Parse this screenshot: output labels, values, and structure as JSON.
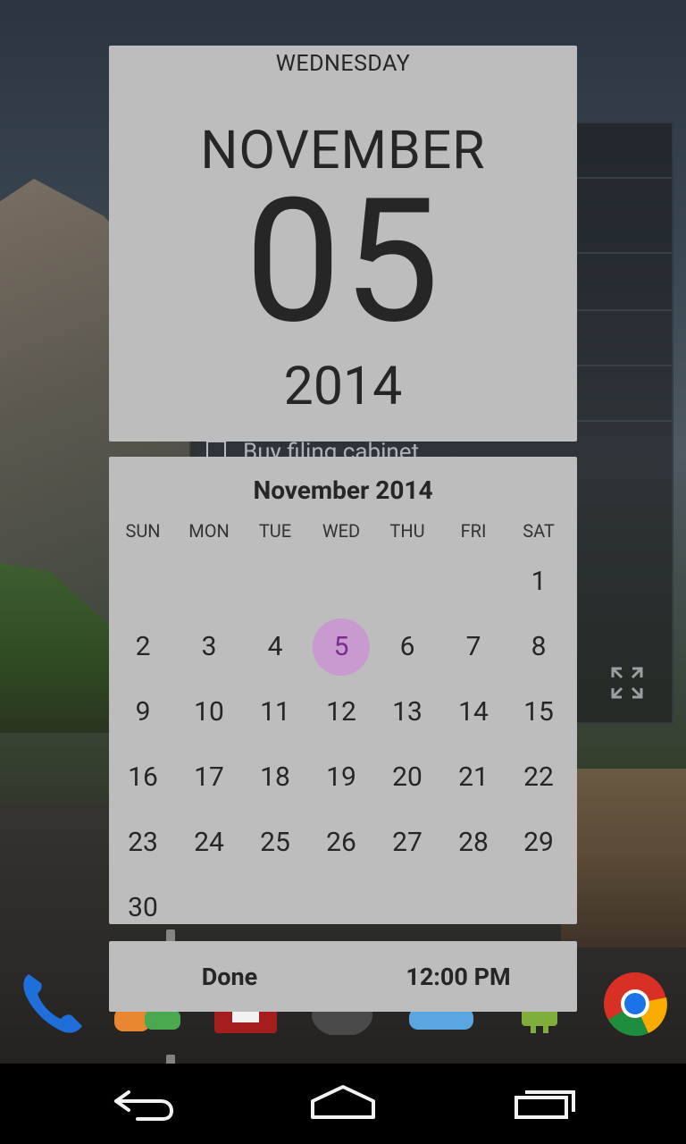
{
  "background_widget": {
    "task_text": "Buy filing cabinet"
  },
  "date_header": {
    "weekday": "WEDNESDAY",
    "month": "NOVEMBER",
    "day": "05",
    "year": "2014"
  },
  "calendar": {
    "title": "November 2014",
    "weekdays": [
      "SUN",
      "MON",
      "TUE",
      "WED",
      "THU",
      "FRI",
      "SAT"
    ],
    "days": [
      "1",
      "2",
      "3",
      "4",
      "5",
      "6",
      "7",
      "8",
      "9",
      "10",
      "11",
      "12",
      "13",
      "14",
      "15",
      "16",
      "17",
      "18",
      "19",
      "20",
      "21",
      "22",
      "23",
      "24",
      "25",
      "26",
      "27",
      "28",
      "29",
      "30"
    ],
    "selected_day": "5",
    "selected_color": "#c99ad0",
    "selected_text_color": "#7b2d8e"
  },
  "actions": {
    "done_label": "Done",
    "time_label": "12:00 PM"
  },
  "dock": {
    "icons": [
      "phone-icon",
      "hangouts-icon",
      "store-icon",
      "camera-icon",
      "weather-icon",
      "android-icon",
      "chrome-icon"
    ]
  },
  "navbar": {
    "icons": [
      "back-icon",
      "home-icon",
      "recents-icon"
    ]
  }
}
